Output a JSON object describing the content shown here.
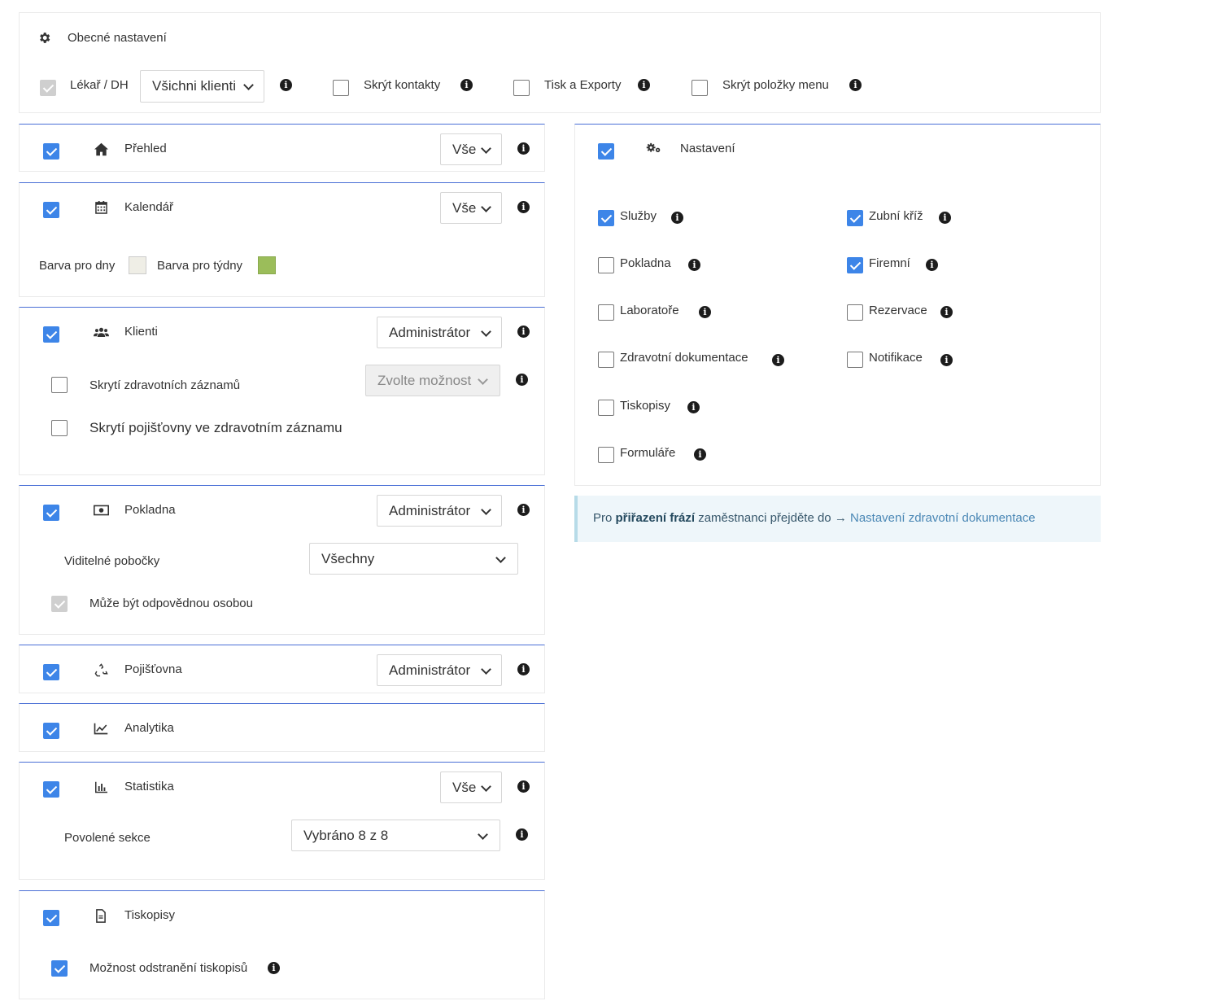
{
  "general": {
    "title": "Obecné nastavení",
    "doctor_label": "Lékař / DH",
    "doctor_select": "Všichni klienti",
    "hide_contacts": "Skrýt kontakty",
    "print_exports": "Tisk a Exporty",
    "hide_menu_items": "Skrýt položky menu"
  },
  "modules": {
    "prehled": {
      "label": "Přehled",
      "select": "Vše"
    },
    "kalendar": {
      "label": "Kalendář",
      "select": "Vše",
      "day_color_label": "Barva pro dny",
      "week_color_label": "Barva pro týdny",
      "day_color": "#efeee6",
      "week_color": "#9bbd5a"
    },
    "klienti": {
      "label": "Klienti",
      "select": "Administrátor",
      "hide_records": "Skrytí zdravotních záznamů",
      "hide_records_select": "Zvolte možnost",
      "hide_insurance": "Skrytí pojišťovny ve zdravotním záznamu"
    },
    "pokladna": {
      "label": "Pokladna",
      "select": "Administrátor",
      "branches_label": "Viditelné pobočky",
      "branches_select": "Všechny",
      "responsible": "Může být odpovědnou osobou"
    },
    "pojistovna": {
      "label": "Pojišťovna",
      "select": "Administrátor"
    },
    "analytika": {
      "label": "Analytika"
    },
    "statistika": {
      "label": "Statistika",
      "select": "Vše",
      "sections_label": "Povolené sekce",
      "sections_select": "Vybráno 8 z 8"
    },
    "tiskopisy": {
      "label": "Tiskopisy",
      "remove": "Možnost odstranění tiskopisů"
    }
  },
  "settings": {
    "label": "Nastavení",
    "left": [
      {
        "label": "Služby",
        "checked": true
      },
      {
        "label": "Pokladna",
        "checked": false
      },
      {
        "label": "Laboratoře",
        "checked": false
      },
      {
        "label": "Zdravotní dokumentace",
        "checked": false
      },
      {
        "label": "Tiskopisy",
        "checked": false
      },
      {
        "label": "Formuláře",
        "checked": false
      }
    ],
    "right": [
      {
        "label": "Zubní kříž",
        "checked": true
      },
      {
        "label": "Firemní",
        "checked": true
      },
      {
        "label": "Rezervace",
        "checked": false
      },
      {
        "label": "Notifikace",
        "checked": false
      }
    ]
  },
  "note": {
    "pre": "Pro ",
    "bold": "přiřazení frází",
    "mid": " zaměstnanci přejděte do → ",
    "link": "Nastavení zdravotní dokumentace"
  },
  "info_glyph": "i"
}
